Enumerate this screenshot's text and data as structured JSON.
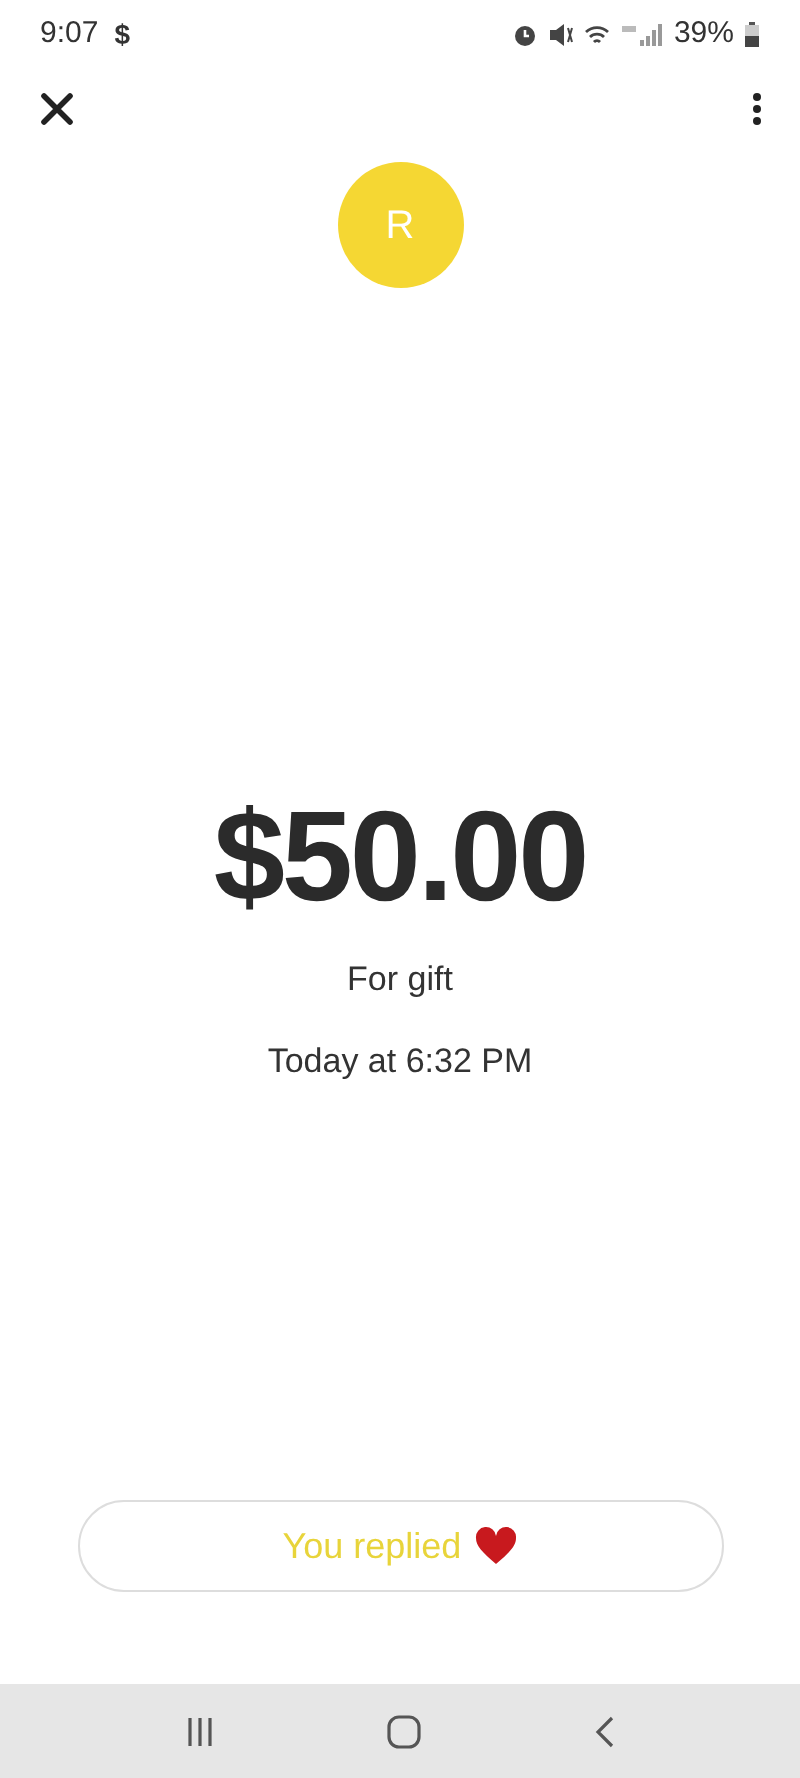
{
  "status_bar": {
    "time": "9:07",
    "app_glyph": "$",
    "battery": "39%"
  },
  "avatar": {
    "initial": "R"
  },
  "payment": {
    "amount": "$50.00",
    "note": "For gift",
    "time": "Today at 6:32 PM"
  },
  "reply_button": {
    "label": "You replied"
  }
}
